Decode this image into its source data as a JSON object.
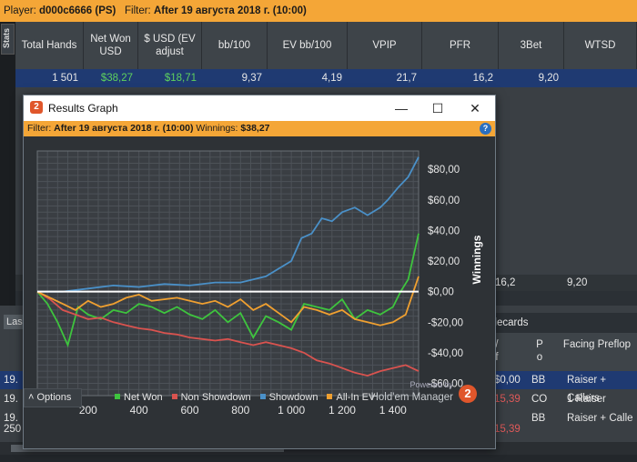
{
  "player_bar": {
    "player_label": "Player:",
    "player": "d000c6666 (PS)",
    "filter_label": "Filter:",
    "filter": "After 19 августа 2018 г. (10:00)"
  },
  "stats_tab": "Stats",
  "stats_table": {
    "headers": [
      "Total Hands",
      "Net Won USD",
      "$ USD (EV adjust",
      "bb/100",
      "EV bb/100",
      "VPIP",
      "PFR",
      "3Bet",
      "WTSD"
    ],
    "row": [
      "1 501",
      "$38,27",
      "$18,71",
      "9,37",
      "4,19",
      "21,7",
      "16,2",
      "9,20",
      ""
    ],
    "row2_pfr": "16,2",
    "row2_3bet": "9,20"
  },
  "bottom": {
    "last_tab": "Las",
    "holecards_header": "olecards",
    "col_won": "/\nf",
    "col_pos": "P\no",
    "col_facing": "Facing Preflop",
    "rows": [
      {
        "left": "19.",
        "won": "$0,00",
        "pos": "BB",
        "facing": "Raiser + Callers",
        "selected": true
      },
      {
        "left": "19.",
        "won": "15,39",
        "pos": "CO",
        "facing": "1 Raiser",
        "selected": false
      },
      {
        "left": "19.",
        "won": "",
        "pos": "BB",
        "facing": "Raiser + Calle",
        "selected": false
      },
      {
        "left": "250",
        "won": "15,39",
        "pos": "",
        "facing": "",
        "selected": false
      }
    ]
  },
  "popup": {
    "title": "Results Graph",
    "minimize": "—",
    "maximize": "☐",
    "close": "✕",
    "filter_label": "Filter:",
    "filter": "After 19 августа 2018 г. (10:00)",
    "winnings_label": "Winnings:",
    "winnings": "$38,27",
    "help": "?",
    "options_label": "Options",
    "powered_by": "Powered by",
    "brand": "Hold'em Manager",
    "brand_badge": "2"
  },
  "chart_data": {
    "type": "line",
    "xlabel": "Hands",
    "ylabel": "Winnings",
    "xlim": [
      0,
      1501
    ],
    "ylim": [
      -68,
      92
    ],
    "x_ticks": [
      200,
      400,
      600,
      800,
      1000,
      1200,
      1400
    ],
    "x_tick_labels": [
      "200",
      "400",
      "600",
      "800",
      "1 000",
      "1 200",
      "1 400"
    ],
    "y_ticks": [
      80,
      60,
      40,
      20,
      0,
      -20,
      -40,
      -60
    ],
    "y_tick_labels": [
      "$80,00",
      "$60,00",
      "$40,00",
      "$20,00",
      "$0,00",
      "-$20,00",
      "-$40,00",
      "-$60,00"
    ],
    "grid": true,
    "legend_position": "bottom",
    "series": [
      {
        "name": "Net Won",
        "color": "#3ec43e",
        "x": [
          0,
          40,
          80,
          120,
          160,
          200,
          250,
          300,
          350,
          400,
          450,
          500,
          550,
          600,
          650,
          700,
          750,
          800,
          850,
          900,
          950,
          1000,
          1050,
          1100,
          1150,
          1200,
          1250,
          1300,
          1350,
          1400,
          1430,
          1460,
          1501
        ],
        "y": [
          0,
          -8,
          -20,
          -35,
          -10,
          -15,
          -18,
          -12,
          -14,
          -8,
          -10,
          -14,
          -10,
          -15,
          -18,
          -12,
          -20,
          -14,
          -30,
          -16,
          -20,
          -25,
          -8,
          -10,
          -12,
          -5,
          -18,
          -12,
          -15,
          -10,
          0,
          8,
          38
        ]
      },
      {
        "name": "Non Showdown",
        "color": "#d9534f",
        "x": [
          0,
          50,
          100,
          150,
          200,
          250,
          300,
          350,
          400,
          450,
          500,
          550,
          600,
          650,
          700,
          750,
          800,
          850,
          900,
          950,
          1000,
          1050,
          1100,
          1150,
          1200,
          1250,
          1300,
          1350,
          1400,
          1450,
          1501
        ],
        "y": [
          0,
          -5,
          -12,
          -15,
          -18,
          -17,
          -20,
          -22,
          -24,
          -25,
          -27,
          -28,
          -30,
          -31,
          -32,
          -31,
          -33,
          -35,
          -33,
          -35,
          -37,
          -40,
          -45,
          -47,
          -50,
          -53,
          -55,
          -52,
          -50,
          -48,
          -52
        ]
      },
      {
        "name": "Showdown",
        "color": "#4a90c8",
        "x": [
          0,
          100,
          200,
          300,
          400,
          500,
          600,
          700,
          800,
          900,
          1000,
          1040,
          1080,
          1120,
          1160,
          1200,
          1250,
          1300,
          1350,
          1380,
          1420,
          1460,
          1501
        ],
        "y": [
          0,
          0,
          2,
          4,
          3,
          5,
          4,
          6,
          6,
          10,
          20,
          35,
          38,
          48,
          46,
          52,
          55,
          50,
          55,
          60,
          68,
          75,
          88
        ]
      },
      {
        "name": "All-In EV",
        "color": "#f0a030",
        "x": [
          0,
          50,
          100,
          150,
          200,
          250,
          300,
          350,
          400,
          450,
          500,
          550,
          600,
          650,
          700,
          750,
          800,
          850,
          900,
          950,
          1000,
          1050,
          1100,
          1150,
          1200,
          1250,
          1300,
          1350,
          1400,
          1450,
          1501
        ],
        "y": [
          0,
          -4,
          -8,
          -12,
          -6,
          -10,
          -8,
          -4,
          -2,
          -6,
          -5,
          -4,
          -6,
          -8,
          -6,
          -10,
          -5,
          -12,
          -8,
          -14,
          -20,
          -10,
          -12,
          -15,
          -12,
          -18,
          -20,
          -22,
          -20,
          -15,
          10
        ]
      }
    ]
  }
}
